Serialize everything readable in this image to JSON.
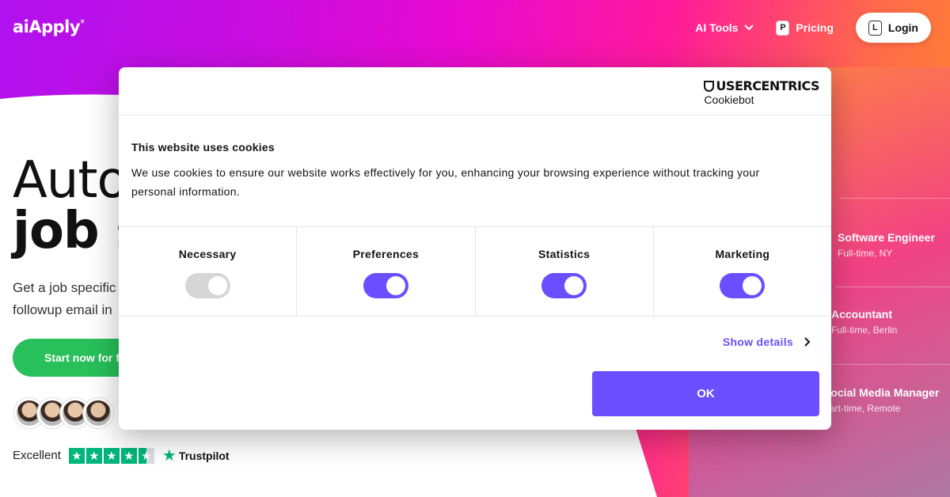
{
  "header": {
    "logo": "aiApply",
    "logo_mark": "*",
    "nav": {
      "ai_tools": "AI Tools",
      "pricing_key": "P",
      "pricing": "Pricing",
      "login_key": "L",
      "login": "Login"
    }
  },
  "hero": {
    "title_line1": "Auto",
    "title_line2": "job s",
    "subtitle_line1": "Get a job specific",
    "subtitle_line2": "followup email in",
    "cta": "Start now for fr",
    "trust_label": "Excellent",
    "trustpilot": "Trustpilot"
  },
  "jobs": [
    {
      "title": "Software Engineer",
      "meta": "Full-time, NY"
    },
    {
      "title": "Accountant",
      "meta": "Full-time, Berlin"
    },
    {
      "title": "Social Media Manager",
      "meta": "Part-time, Remote"
    }
  ],
  "cookie_modal": {
    "brand": "USERCENTRICS",
    "brand_sub": "Cookiebot",
    "title": "This website uses cookies",
    "text": "We use cookies to ensure our website works effectively for you, enhancing your browsing experience without tracking your personal information.",
    "toggles": [
      {
        "label": "Necessary",
        "on": true,
        "disabled": true
      },
      {
        "label": "Preferences",
        "on": true,
        "disabled": false
      },
      {
        "label": "Statistics",
        "on": true,
        "disabled": false
      },
      {
        "label": "Marketing",
        "on": true,
        "disabled": false
      }
    ],
    "show_details": "Show details",
    "ok": "OK"
  },
  "colors": {
    "accent": "#6b4eff",
    "cta_green": "#27c05a",
    "trustpilot_green": "#00b67a"
  },
  "icons": [
    "chevron-down-icon",
    "chevron-right-icon",
    "usercentrics-shield-icon",
    "trustpilot-star-icon"
  ]
}
